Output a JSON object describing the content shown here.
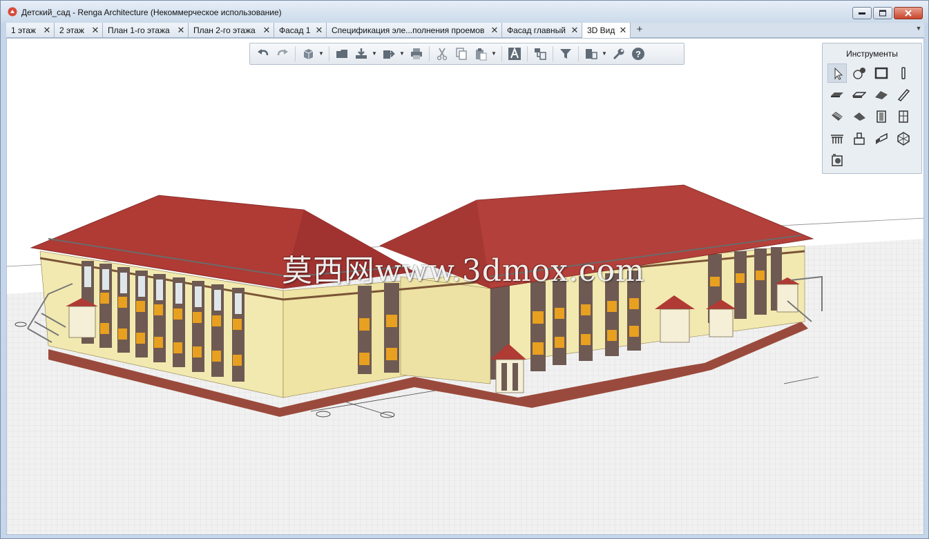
{
  "window": {
    "title": "Детский_сад - Renga Architecture (Некоммерческое использование)"
  },
  "tabs": [
    {
      "label": "1 этаж",
      "active": false
    },
    {
      "label": "2 этаж",
      "active": false
    },
    {
      "label": "План 1-го этажа",
      "active": false
    },
    {
      "label": "План 2-го этажа",
      "active": false
    },
    {
      "label": "Фасад 1",
      "active": false
    },
    {
      "label": "Спецификация эле...полнения проемов",
      "active": false
    },
    {
      "label": "Фасад главный",
      "active": false
    },
    {
      "label": "3D Вид",
      "active": true
    }
  ],
  "tab_add_label": "+",
  "tools_panel": {
    "title": "Инструменты"
  },
  "watermark": "莫西网www.3dmox.com",
  "colors": {
    "roof": "#b03a34",
    "wall": "#f2e9b0",
    "window_panel": "#e8a020",
    "base": "#9a4a3c",
    "grid": "#c9c9c9"
  },
  "icons": {
    "toolbar": [
      "undo-icon",
      "redo-icon",
      "view-cube-icon",
      "folder-icon",
      "import-icon",
      "export-icon",
      "print-icon",
      "cut-icon",
      "copy-icon",
      "paste-icon",
      "text-style-icon",
      "layers-icon",
      "filter-icon",
      "visibility-icon",
      "settings-wrench-icon",
      "help-icon"
    ],
    "tools": [
      "select-icon",
      "annotation-icon",
      "room-icon",
      "column-icon",
      "slab-icon",
      "floor-icon",
      "roof-icon",
      "beam-icon",
      "stair-icon",
      "ramp-icon",
      "door-icon",
      "window-icon",
      "railing-icon",
      "equipment-icon",
      "opening-icon",
      "assembly-icon",
      "element-icon"
    ]
  }
}
